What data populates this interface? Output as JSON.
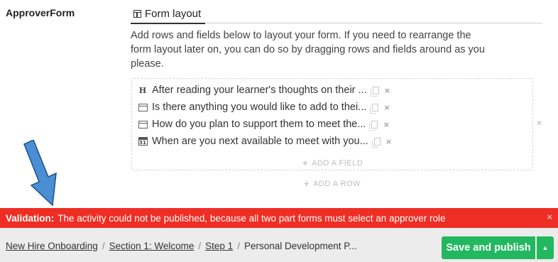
{
  "form_label": "ApproverForm",
  "tab": {
    "label": "Form layout"
  },
  "description": "Add rows and fields below to layout your form. If you need to rearrange the form layout later on, you can do so by dragging rows and fields around as you please.",
  "fields": [
    {
      "icon": "heading-icon",
      "icon_text": "H",
      "label": "After reading your learner's thoughts on their ..."
    },
    {
      "icon": "text-field-icon",
      "icon_text": "",
      "label": "Is there anything you would like to add to thei..."
    },
    {
      "icon": "text-field-icon",
      "icon_text": "",
      "label": "How do you plan to support them to meet the..."
    },
    {
      "icon": "calendar-icon",
      "icon_text": "31",
      "label": "When are you next available to meet with you..."
    }
  ],
  "add_field_label": "ADD A FIELD",
  "add_row_label": "ADD A ROW",
  "validation": {
    "prefix": "Validation:",
    "message": "The activity could not be published, because all two part forms must select an approver role"
  },
  "breadcrumbs": [
    "New Hire Onboarding",
    "Section 1: Welcome",
    "Step 1",
    "Personal Development P..."
  ],
  "breadcrumb_separator": "/",
  "actions": {
    "publish_label": "Save and publish"
  },
  "colors": {
    "banner": "#ee2e24",
    "publish": "#22b85f",
    "arrow": "#4a8fd4"
  }
}
